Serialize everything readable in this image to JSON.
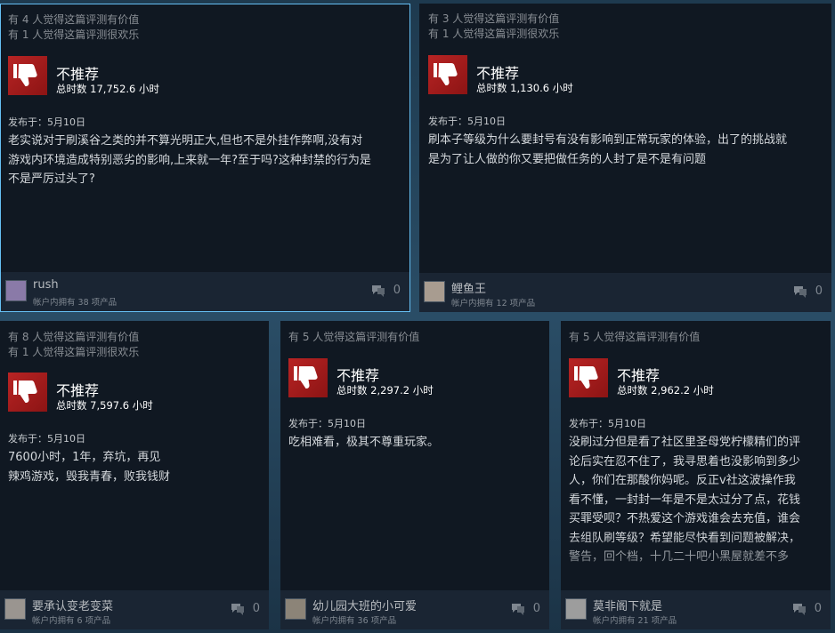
{
  "reviews": [
    {
      "helpful": [
        "有 4 人觉得这篇评测有价值",
        "有 1 人觉得这篇评测很欢乐"
      ],
      "recommendation": "不推荐",
      "hours": "总时数 17,752.6 小时",
      "posted": "发布于：5月10日",
      "content": "老实说对于刷溪谷之类的并不算光明正大,但也不是外挂作弊啊,没有对\n游戏内环境造成特别恶劣的影响,上来就一年?至于吗?这种封禁的行为是\n不是严厉过头了?",
      "author": "rush",
      "owns": "帐户内拥有 38 项产品",
      "comments": "0"
    },
    {
      "helpful": [
        "有 3 人觉得这篇评测有价值",
        "有 1 人觉得这篇评测很欢乐"
      ],
      "recommendation": "不推荐",
      "hours": "总时数 1,130.6 小时",
      "posted": "发布于：5月10日",
      "content": "刷本子等级为什么要封号有没有影响到正常玩家的体验，出了的挑战就\n是为了让人做的你又要把做任务的人封了是不是有问题",
      "author": "鲤鱼王",
      "owns": "帐户内拥有 12 项产品",
      "comments": "0"
    },
    {
      "helpful": [
        "有 8 人觉得这篇评测有价值",
        "有 1 人觉得这篇评测很欢乐"
      ],
      "recommendation": "不推荐",
      "hours": "总时数 7,597.6 小时",
      "posted": "发布于：5月10日",
      "content": "7600小时，1年，弃坑，再见\n辣鸡游戏，毁我青春，败我钱财",
      "author": "要承认变老变菜",
      "owns": "帐户内拥有 6 项产品",
      "comments": "0"
    },
    {
      "helpful": [
        "有 5 人觉得这篇评测有价值"
      ],
      "recommendation": "不推荐",
      "hours": "总时数 2,297.2 小时",
      "posted": "发布于：5月10日",
      "content": "吃相难看，极其不尊重玩家。",
      "author": "幼儿园大班的小可爱",
      "owns": "帐户内拥有 36 项产品",
      "comments": "0"
    },
    {
      "helpful": [
        "有 5 人觉得这篇评测有价值"
      ],
      "recommendation": "不推荐",
      "hours": "总时数 2,962.2 小时",
      "posted": "发布于：5月10日",
      "content": "没刷过分但是看了社区里圣母党柠檬精们的评\n论后实在忍不住了，我寻思着也没影响到多少\n人，你们在那酸你妈呢。反正v社这波操作我\n看不懂，一封封一年是不是太过分了点，花钱\n买罪受呗？不热爱这个游戏谁会去充值，谁会\n去组队刷等级？希望能尽快看到问题被解决，\n警告，回个档，十几二十吧小黑屋就差不多",
      "author": "莫非阁下就是",
      "owns": "帐户内拥有 21 项产品",
      "comments": "0"
    }
  ]
}
